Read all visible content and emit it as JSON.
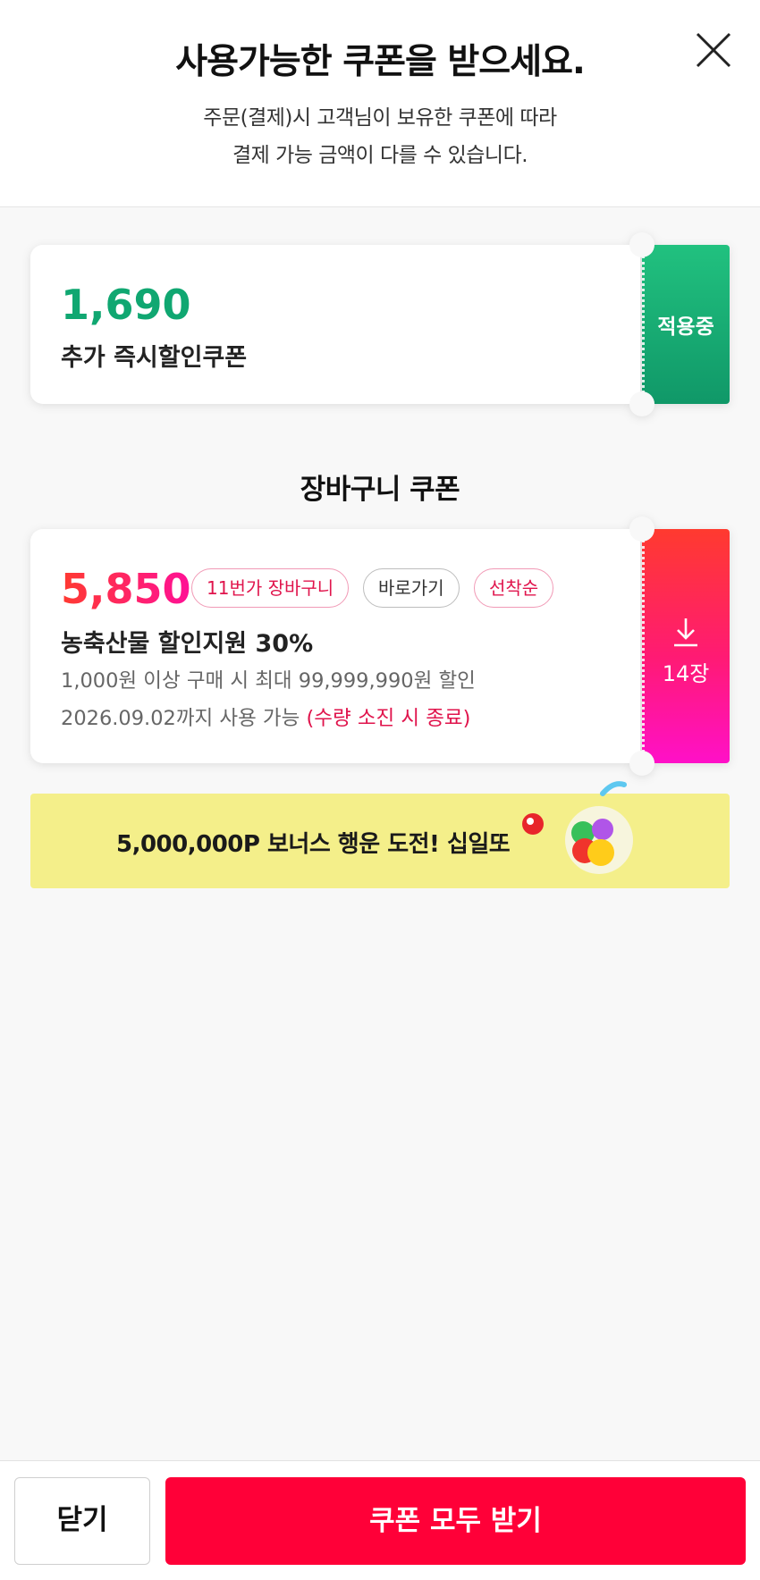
{
  "header": {
    "title": "사용가능한 쿠폰을 받으세요.",
    "subtitle_line1": "주문(결제)시 고객님이 보유한 쿠폰에 따라",
    "subtitle_line2": "결제 가능 금액이 다를 수 있습니다.",
    "close_icon": "close-icon"
  },
  "applied_coupon": {
    "amount": "1,690",
    "name": "추가 즉시할인쿠폰",
    "status": "적용중",
    "accent_color": "#10a771"
  },
  "cart_section": {
    "title": "장바구니 쿠폰"
  },
  "cart_coupon": {
    "amount": "5,850",
    "tags": [
      "11번가 장바구니",
      "바로가기",
      "선착순"
    ],
    "name": "농축산물 할인지원 30%",
    "condition": "1,000원 이상 구매 시 최대 99,999,990원 할인",
    "validity": "2026.09.02까지 사용 가능",
    "warning": "(수량 소진 시 종료)",
    "download_icon": "download-icon",
    "count": "14장",
    "accent_color": "#ff1a74"
  },
  "banner": {
    "text": "5,000,000P 보너스 행운 도전! 십일또",
    "background": "#f4ef8a"
  },
  "footer": {
    "close_label": "닫기",
    "get_all_label": "쿠폰 모두 받기",
    "primary_color": "#ff0038"
  }
}
